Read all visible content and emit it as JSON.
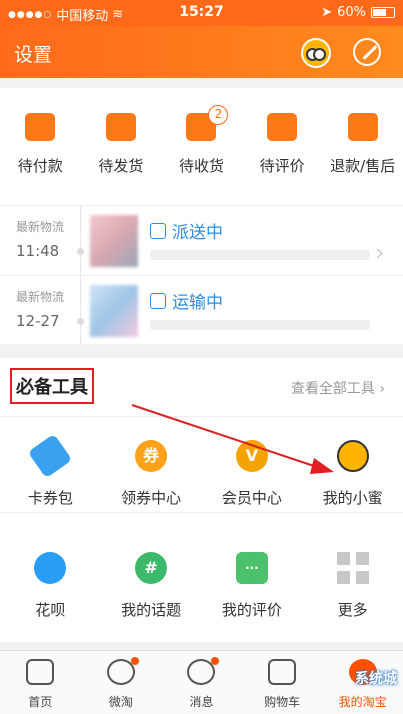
{
  "status": {
    "carrier": "中国移动",
    "time": "15:27",
    "battery": "60%"
  },
  "header": {
    "title": "设置"
  },
  "orders": [
    {
      "label": "待付款",
      "icon": "wallet-icon"
    },
    {
      "label": "待发货",
      "icon": "package-icon"
    },
    {
      "label": "待收货",
      "icon": "delivery-truck-icon",
      "badge": "2"
    },
    {
      "label": "待评价",
      "icon": "flower-icon"
    },
    {
      "label": "退款/售后",
      "icon": "refund-icon"
    }
  ],
  "logistics": [
    {
      "label": "最新物流",
      "time": "11:48",
      "status": "派送中"
    },
    {
      "label": "最新物流",
      "time": "12-27",
      "status": "运输中"
    }
  ],
  "tools": {
    "title": "必备工具",
    "see_all": "查看全部工具",
    "row1": [
      {
        "label": "卡券包",
        "icon": "ticket-icon",
        "color": "#3aa0f0"
      },
      {
        "label": "领券中心",
        "icon": "coupon-icon",
        "glyph": "券",
        "color": "#ffa21a"
      },
      {
        "label": "会员中心",
        "icon": "vip-icon",
        "glyph": "V",
        "color": "#f5a300"
      },
      {
        "label": "我的小蜜",
        "icon": "bee-assistant-icon",
        "color": "#ffb400"
      }
    ],
    "row2": [
      {
        "label": "花呗",
        "icon": "huabei-icon",
        "color": "#2a9df4"
      },
      {
        "label": "我的话题",
        "icon": "hashtag-icon",
        "glyph": "#",
        "color": "#3cb96a"
      },
      {
        "label": "我的评价",
        "icon": "chat-bubble-icon",
        "glyph": "···",
        "color": "#4cc06b"
      },
      {
        "label": "更多",
        "icon": "grid-more-icon",
        "color": "#c8c8c8"
      }
    ]
  },
  "tabbar": [
    {
      "label": "首页",
      "icon": "home-icon"
    },
    {
      "label": "微淘",
      "icon": "weitao-icon",
      "dot": true
    },
    {
      "label": "消息",
      "icon": "message-icon",
      "dot": true
    },
    {
      "label": "购物车",
      "icon": "cart-icon"
    },
    {
      "label": "我的淘宝",
      "icon": "my-taobao-icon",
      "active": true
    }
  ],
  "watermark": "系统城"
}
